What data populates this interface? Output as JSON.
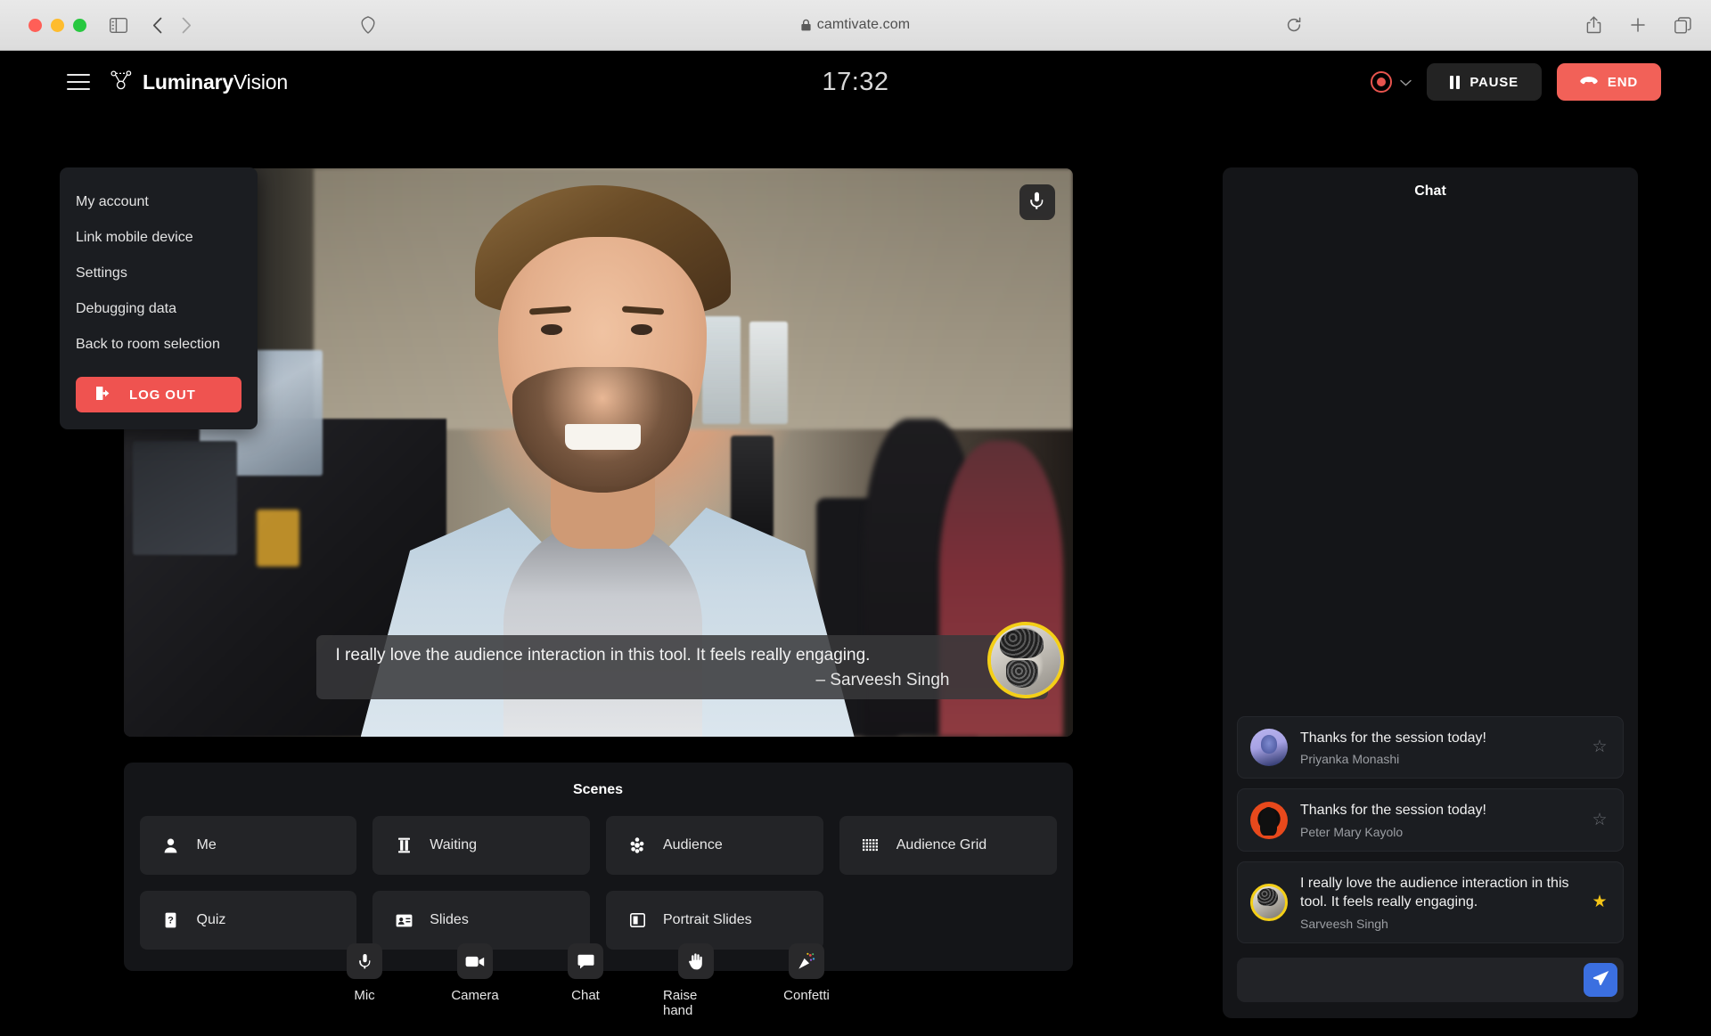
{
  "browser": {
    "url": "camtivate.com",
    "lock_icon": "lock-icon",
    "sidebar_icon": "sidebar-toggle-icon",
    "back_icon": "back-arrow-icon",
    "forward_icon": "forward-arrow-icon",
    "shield_icon": "privacy-shield-icon",
    "reload_icon": "reload-icon",
    "share_icon": "share-icon",
    "new_tab_icon": "plus-icon",
    "tabs_icon": "tab-overview-icon"
  },
  "topbar": {
    "menu_icon": "hamburger-menu-icon",
    "logo_icon": "luminary-network-logo-icon",
    "brand_bold": "Luminary",
    "brand_light": "Vision",
    "timer": "17:32",
    "record_icon": "record-dot-icon",
    "record_chevron": "chevron-down-icon",
    "pause_label": "PAUSE",
    "end_label": "END"
  },
  "account_menu": {
    "items": [
      {
        "label": "My account"
      },
      {
        "label": "Link mobile device"
      },
      {
        "label": "Settings"
      },
      {
        "label": "Debugging data"
      },
      {
        "label": "Back to room selection"
      }
    ],
    "logout_label": "LOG OUT",
    "logout_icon": "logout-icon"
  },
  "video": {
    "mic_icon": "microphone-icon",
    "caption_text": "I really love the audience interaction in this tool. It feels really engaging.",
    "caption_author": "– Sarveesh Singh"
  },
  "scenes": {
    "title": "Scenes",
    "items": [
      {
        "label": "Me",
        "icon": "person-icon"
      },
      {
        "label": "Waiting",
        "icon": "hourglass-icon"
      },
      {
        "label": "Audience",
        "icon": "audience-cluster-icon"
      },
      {
        "label": "Audience Grid",
        "icon": "grid-icon"
      },
      {
        "label": "Quiz",
        "icon": "quiz-icon"
      },
      {
        "label": "Slides",
        "icon": "slides-icon"
      },
      {
        "label": "Portrait Slides",
        "icon": "portrait-slides-icon"
      }
    ]
  },
  "toolbar": {
    "items": [
      {
        "label": "Mic",
        "icon": "microphone-icon"
      },
      {
        "label": "Camera",
        "icon": "camera-icon"
      },
      {
        "label": "Chat",
        "icon": "chat-bubble-icon"
      },
      {
        "label": "Raise hand",
        "icon": "raised-hand-icon"
      },
      {
        "label": "Confetti",
        "icon": "confetti-icon"
      }
    ]
  },
  "chat": {
    "title": "Chat",
    "messages": [
      {
        "text": "Thanks for the session today!",
        "author": "Priyanka Monashi",
        "starred": false,
        "star_glyph": "☆"
      },
      {
        "text": "Thanks for the session today!",
        "author": "Peter Mary Kayolo",
        "starred": false,
        "star_glyph": "☆"
      },
      {
        "text": "I really love the audience interaction in this tool. It feels really engaging.",
        "author": "Sarveesh Singh",
        "starred": true,
        "star_glyph": "★"
      }
    ],
    "input_value": "",
    "input_placeholder": "",
    "send_icon": "send-paper-plane-icon"
  },
  "colors": {
    "accent_red": "#f26158",
    "logout_red": "#ef5350",
    "send_blue": "#3b6fe0",
    "star_gold": "#f4c417",
    "panel_bg": "#141518",
    "card_bg": "#232427"
  }
}
